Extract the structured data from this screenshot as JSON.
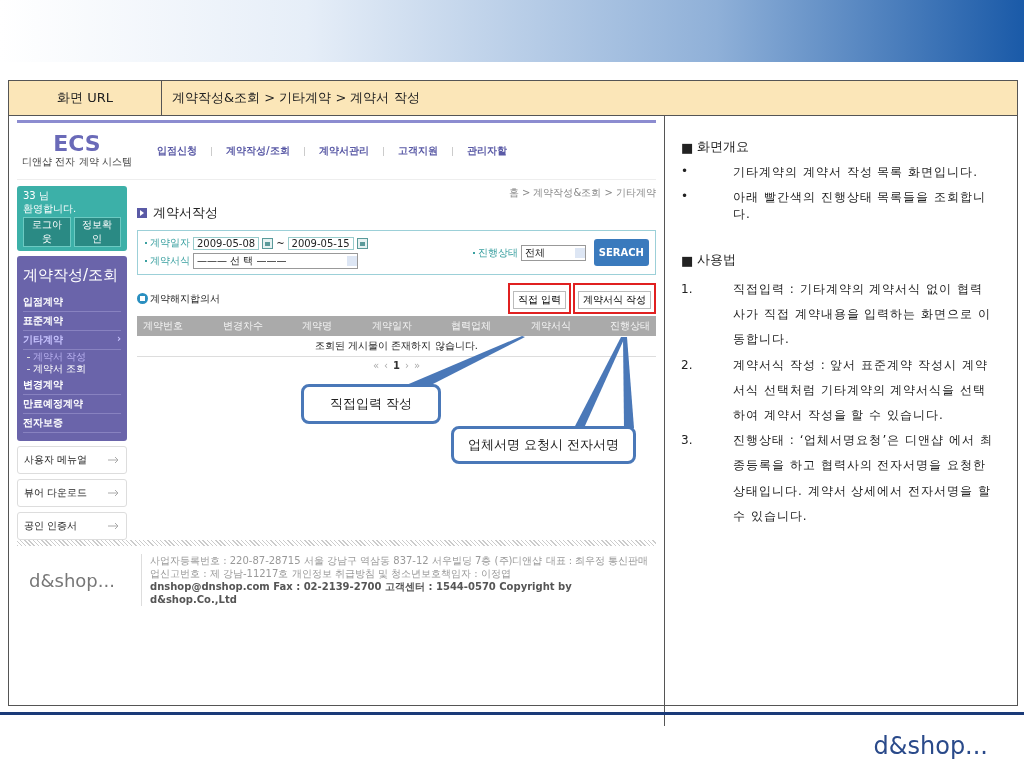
{
  "header": {
    "url_label": "화면 URL",
    "path": "계약작성&조회 > 기타계약 > 계약서 작성"
  },
  "app": {
    "logo": "ECS",
    "logo_sub": "디앤샵 전자 계약 시스템",
    "nav": [
      "입점신청",
      "계약작성/조회",
      "계약서관리",
      "고객지원",
      "관리자할"
    ],
    "welcome": {
      "user": "33 님",
      "greeting": "환영합니다.",
      "buttons": [
        "로그아웃",
        "정보확인"
      ]
    },
    "menu": {
      "title": "계약작성/조회",
      "items": [
        {
          "label": "입점계약",
          "selected": false
        },
        {
          "label": "표준계약",
          "selected": false
        },
        {
          "label": "기타계약",
          "selected": true,
          "arrow": "›",
          "children": [
            {
              "label": "계약서 작성",
              "selected": true
            },
            {
              "label": "계약서 조회",
              "selected": false
            }
          ]
        },
        {
          "label": "변경계약",
          "selected": false
        },
        {
          "label": "만료예정계약",
          "selected": false
        },
        {
          "label": "전자보증",
          "selected": false
        }
      ]
    },
    "links": [
      "사용자 메뉴얼",
      "뷰어 다운로드",
      "공인 인증서"
    ],
    "breadcrumb": "홈 > 계약작성&조회 > 기타계약",
    "page_title": "계약서작성",
    "search": {
      "date_label": "계약일자",
      "date_from": "2009-05-08",
      "separator": "~",
      "date_to": "2009-05-15",
      "form_label": "계약서식",
      "form_value": "——— 선 택 ———",
      "status_label": "진행상태",
      "status_value": "전체",
      "button": "SERACH"
    },
    "section_title": "계약해지합의서",
    "actions": [
      {
        "label": "직접 입력",
        "highlighted": true
      },
      {
        "label": "계약서식 작성",
        "highlighted": true
      }
    ],
    "table": {
      "columns": [
        "계약번호",
        "변경차수",
        "계약명",
        "계약일자",
        "협력업체",
        "계약서식",
        "진행상태"
      ],
      "empty_message": "조회된 게시물이 존재하지 않습니다."
    },
    "pagination": [
      "«",
      "‹",
      "1",
      "›",
      "»"
    ],
    "footer": {
      "logo": "d&shop...",
      "lines": [
        "사업자등록번호 : 220-87-28715 서울 강남구 역삼동 837-12 서우빌딩 7층 (주)디앤샵 대표 : 최우정 통신판매업신고번호 : 제 강남-11217호 개인정보 취급방침 및 청소년보호책임자 : 이정엽",
        "dnshop@dnshop.com Fax : 02-2139-2700 고객센터 : 1544-0570 Copyright by d&shop.Co.,Ltd"
      ]
    }
  },
  "callouts": [
    "직접입력 작성",
    "업체서명 요청시 전자서명"
  ],
  "description": [
    {
      "title": "화면개요",
      "marker": "■",
      "items": [
        {
          "marker": "•",
          "text": "기타계약의 계약서 작성 목록 화면입니다."
        },
        {
          "marker": "•",
          "text": "아래 빨간색의 진행상태 목록들을 조회합니다."
        }
      ]
    },
    {
      "title": "사용법",
      "marker": "■",
      "items": [
        {
          "marker": "1.",
          "text": "직접입력 : 기타계약의 계약서식 없이 협력 사가 직접 계약내용을 입력하는 화면으로 이동합니다."
        },
        {
          "marker": "2.",
          "text": "계약서식 작성 : 앞서 표준계약 작성시 계약서식 선택처럼 기타계약의 계약서식을 선택하여 계약서 작성을 할 수 있습니다."
        },
        {
          "marker": "3.",
          "text": "진행상태 : ‘업체서명요청’은 디앤샵 에서 최종등록을 하고 협력사의 전자서명을 요청한 상태입니다. 계약서 상세에서 전자서명을 할 수 있습니다."
        }
      ]
    }
  ],
  "brand_logo": "d&shop..."
}
